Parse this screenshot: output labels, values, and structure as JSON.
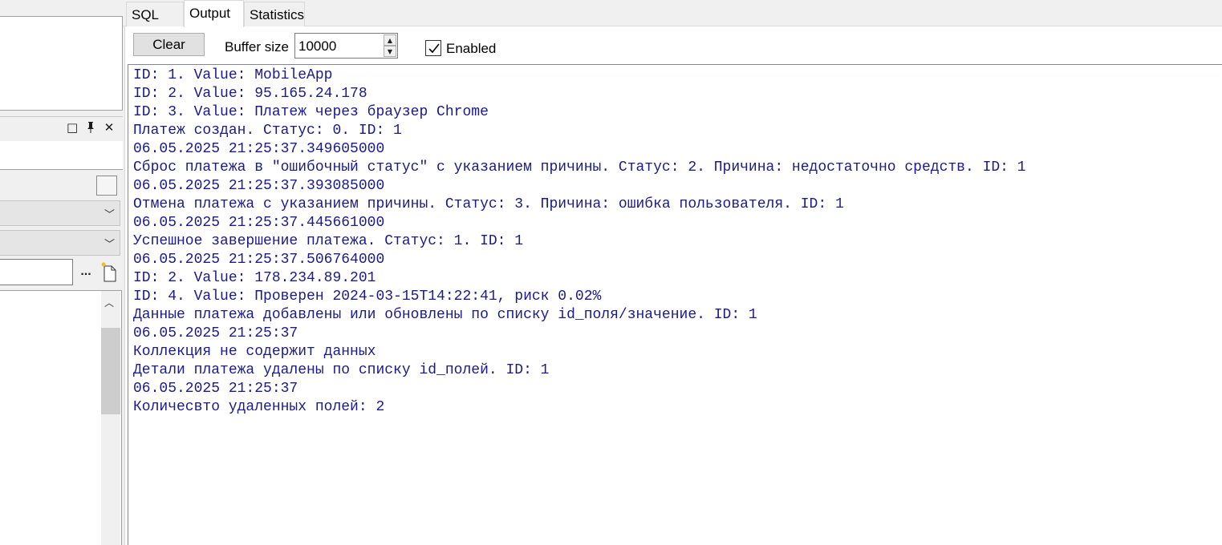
{
  "tabs": [
    {
      "label": "SQL",
      "active": false
    },
    {
      "label": "Output",
      "active": true
    },
    {
      "label": "Statistics",
      "active": false
    }
  ],
  "toolbar": {
    "clear_label": "Clear",
    "buffer_label": "Buffer size",
    "buffer_value": "10000",
    "enabled_label": "Enabled",
    "enabled_checked": true
  },
  "left_panel": {
    "ellipsis_label": "...",
    "icons": [
      "restore-icon",
      "pin-icon",
      "close-icon",
      "chevron-down-icon",
      "new-file-icon",
      "scroll-up-icon"
    ]
  },
  "output_lines": [
    "ID: 1. Value: MobileApp",
    "ID: 2. Value: 95.165.24.178",
    "ID: 3. Value: Платеж через браузер Chrome",
    "Платеж создан. Статус: 0. ID: 1",
    "06.05.2025 21:25:37.349605000",
    "Сброс платежа в \"ошибочный статус\" с указанием причины. Статус: 2. Причина: недостаточно средств. ID: 1",
    "06.05.2025 21:25:37.393085000",
    "Отмена платежа с указанием причины. Статус: 3. Причина: ошибка пользователя. ID: 1",
    "06.05.2025 21:25:37.445661000",
    "Успешное завершение платежа. Статус: 1. ID: 1",
    "06.05.2025 21:25:37.506764000",
    "ID: 2. Value: 178.234.89.201",
    "ID: 4. Value: Проверен 2024-03-15T14:22:41, риск 0.02%",
    "Данные платежа добавлены или обновлены по списку id_поля/значение. ID: 1",
    "06.05.2025 21:25:37",
    "Коллекция не содержит данных",
    "Детали платежа удалены по списку id_полей. ID: 1",
    "06.05.2025 21:25:37",
    "Количесвто удаленных полей: 2"
  ],
  "colors": {
    "output_text": "#1a1a8c",
    "background": "#f0f0f0"
  }
}
